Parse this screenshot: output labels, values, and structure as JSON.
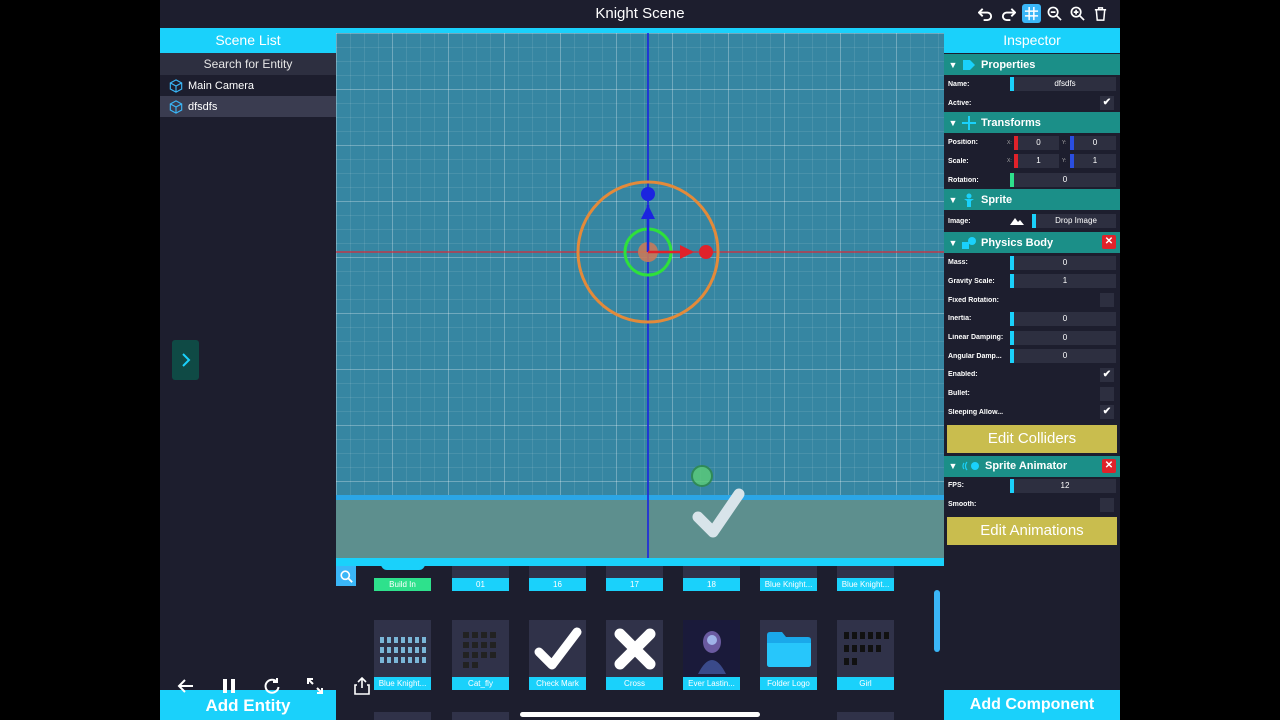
{
  "window": {
    "title": "Knight Scene"
  },
  "toolbar": {
    "tools": [
      "undo-icon",
      "redo-icon",
      "grid-icon",
      "zoom-out-icon",
      "zoom-in-icon",
      "trash-icon"
    ]
  },
  "scene_list": {
    "header": "Scene List",
    "search_placeholder": "Search for Entity",
    "entities": [
      "Main Camera",
      "dfsdfs"
    ],
    "selected": "dfsdfs",
    "add_entity_label": "Add Entity"
  },
  "assets": {
    "top_row": [
      "Build In",
      "01",
      "16",
      "17",
      "18",
      "Blue Knight...",
      "Blue Knight..."
    ],
    "middle_row": [
      "Blue Knight...",
      "Cat_fly",
      "Check Mark",
      "Cross",
      "Ever Lastin...",
      "Folder Logo",
      "Girl"
    ]
  },
  "inspector": {
    "header": "Inspector",
    "properties": {
      "title": "Properties",
      "name_label": "Name:",
      "name_value": "dfsdfs",
      "active_label": "Active:",
      "active": true
    },
    "transforms": {
      "title": "Transforms",
      "position_label": "Position:",
      "position_x": "0",
      "position_y": "0",
      "scale_label": "Scale:",
      "scale_x": "1",
      "scale_y": "1",
      "rotation_label": "Rotation:",
      "rotation": "0",
      "x_axis": "X:",
      "y_axis": "Y:"
    },
    "sprite": {
      "title": "Sprite",
      "image_label": "Image:",
      "drop_label": "Drop Image"
    },
    "physics_body": {
      "title": "Physics Body",
      "mass_label": "Mass:",
      "mass": "0",
      "gravity_label": "Gravity Scale:",
      "gravity": "1",
      "fixed_rotation_label": "Fixed Rotation:",
      "inertia_label": "Inertia:",
      "inertia": "0",
      "linear_damping_label": "Linear Damping:",
      "linear_damping": "0",
      "angular_damping_label": "Angular Damp...",
      "angular_damping": "0",
      "enabled_label": "Enabled:",
      "bullet_label": "Bullet:",
      "sleeping_label": "Sleeping Allow...",
      "edit_colliders": "Edit Colliders"
    },
    "sprite_animator": {
      "title": "Sprite Animator",
      "fps_label": "FPS:",
      "fps": "12",
      "smooth_label": "Smooth:",
      "edit_animations": "Edit Animations"
    },
    "add_component": "Add Component"
  },
  "colors": {
    "accent": "#1ad1fb",
    "section": "#1b8f88",
    "button": "#c9bd4e",
    "delete": "#e0222a",
    "panel": "#1d1e2e"
  }
}
